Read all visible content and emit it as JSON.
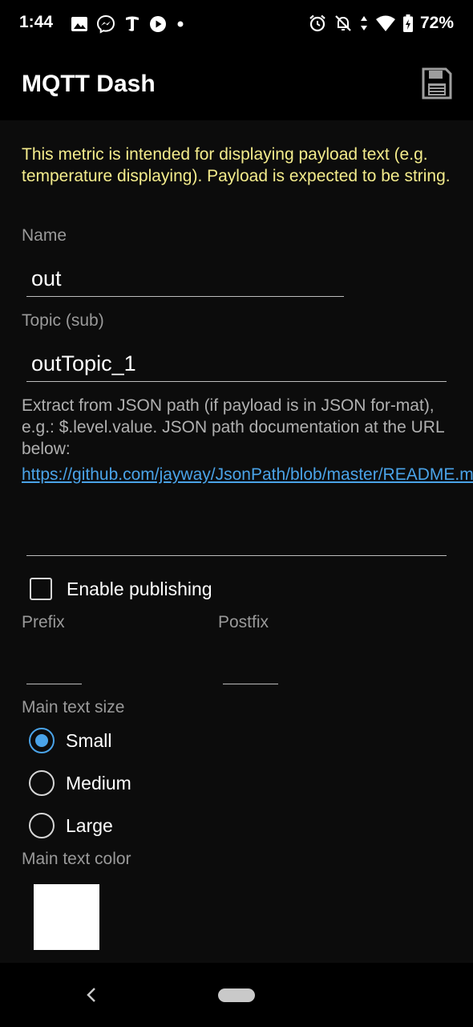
{
  "status_bar": {
    "time": "1:44",
    "battery": "72%",
    "left_icons": [
      "image-icon",
      "messenger-icon",
      "nytimes-icon",
      "play-icon",
      "dot-icon"
    ],
    "right_icons": [
      "alarm-icon",
      "bell-off-icon",
      "data-arrows-icon",
      "wifi-icon",
      "battery-charging-icon"
    ]
  },
  "app_bar": {
    "title": "MQTT Dash",
    "save_icon": "save-icon"
  },
  "form": {
    "description": "This metric is intended for displaying payload text (e.g. temperature displaying). Payload is expected to be string.",
    "name_label": "Name",
    "name_value": "out",
    "topic_label": "Topic (sub)",
    "topic_value": "outTopic_1",
    "json_info": "Extract from JSON path (if payload is in JSON for-mat), e.g.: $.level.value. JSON path documentation at the URL below:",
    "json_link": "https://github.com/jayway/JsonPath/blob/master/README.md",
    "json_value": "",
    "enable_publishing_label": "Enable publishing",
    "enable_publishing_checked": false,
    "prefix_label": "Prefix",
    "prefix_value": "",
    "postfix_label": "Postfix",
    "postfix_value": "",
    "text_size_label": "Main text size",
    "text_size_options": [
      {
        "label": "Small",
        "selected": true
      },
      {
        "label": "Medium",
        "selected": false
      },
      {
        "label": "Large",
        "selected": false
      }
    ],
    "text_color_label": "Main text color",
    "text_color": "#ffffff"
  },
  "colors": {
    "accent": "#4aa3e8",
    "description_text": "#f4ec8c",
    "background": "#0c0c0c"
  },
  "nav_bar": {
    "back_icon": "back-chevron-icon",
    "home_icon": "home-pill-icon"
  }
}
